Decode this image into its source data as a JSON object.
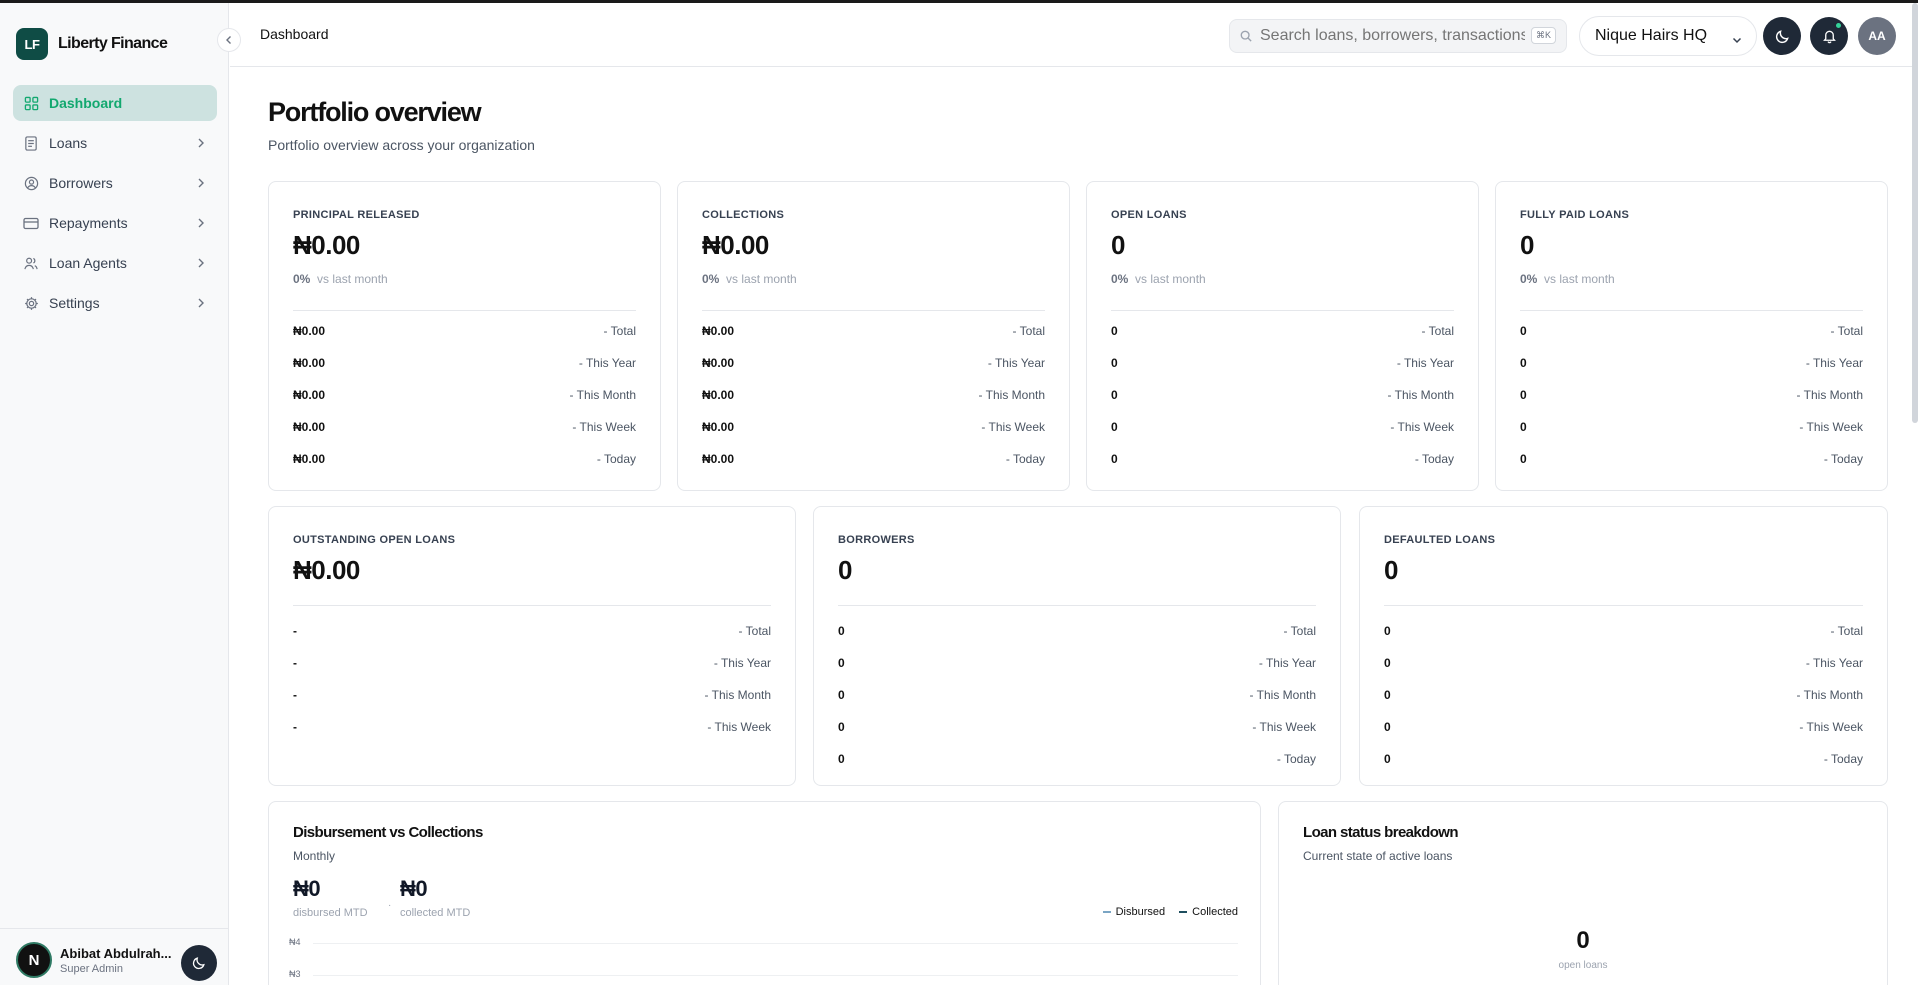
{
  "app": {
    "logo_initials": "LF",
    "name": "Liberty Finance"
  },
  "sidebar": {
    "items": [
      {
        "label": "Dashboard",
        "icon": "grid-icon",
        "active": true
      },
      {
        "label": "Loans",
        "icon": "document-icon"
      },
      {
        "label": "Borrowers",
        "icon": "user-circle-icon"
      },
      {
        "label": "Repayments",
        "icon": "credit-card-icon"
      },
      {
        "label": "Loan Agents",
        "icon": "users-icon"
      },
      {
        "label": "Settings",
        "icon": "gear-icon"
      }
    ],
    "user": {
      "avatar_letter": "N",
      "name": "Abibat Abdulrah...",
      "role": "Super Admin"
    }
  },
  "topbar": {
    "breadcrumb": "Dashboard",
    "search_placeholder": "Search loans, borrowers, transactions",
    "search_shortcut": "⌘K",
    "org_name": "Nique Hairs HQ",
    "avatar_initials": "AA"
  },
  "page": {
    "title": "Portfolio overview",
    "subtitle": "Portfolio overview across your organization"
  },
  "cards_row1": [
    {
      "label": "PRINCIPAL RELEASED",
      "value": "₦0.00",
      "delta_pct": "0%",
      "delta_text": "vs last month",
      "rows": [
        {
          "v": "₦0.00",
          "p": "- Total"
        },
        {
          "v": "₦0.00",
          "p": "- This Year"
        },
        {
          "v": "₦0.00",
          "p": "- This Month"
        },
        {
          "v": "₦0.00",
          "p": "- This Week"
        },
        {
          "v": "₦0.00",
          "p": "- Today"
        }
      ]
    },
    {
      "label": "COLLECTIONS",
      "value": "₦0.00",
      "delta_pct": "0%",
      "delta_text": "vs last month",
      "rows": [
        {
          "v": "₦0.00",
          "p": "- Total"
        },
        {
          "v": "₦0.00",
          "p": "- This Year"
        },
        {
          "v": "₦0.00",
          "p": "- This Month"
        },
        {
          "v": "₦0.00",
          "p": "- This Week"
        },
        {
          "v": "₦0.00",
          "p": "- Today"
        }
      ]
    },
    {
      "label": "OPEN LOANS",
      "value": "0",
      "delta_pct": "0%",
      "delta_text": "vs last month",
      "rows": [
        {
          "v": "0",
          "p": "- Total"
        },
        {
          "v": "0",
          "p": "- This Year"
        },
        {
          "v": "0",
          "p": "- This Month"
        },
        {
          "v": "0",
          "p": "- This Week"
        },
        {
          "v": "0",
          "p": "- Today"
        }
      ]
    },
    {
      "label": "FULLY PAID LOANS",
      "value": "0",
      "delta_pct": "0%",
      "delta_text": "vs last month",
      "rows": [
        {
          "v": "0",
          "p": "- Total"
        },
        {
          "v": "0",
          "p": "- This Year"
        },
        {
          "v": "0",
          "p": "- This Month"
        },
        {
          "v": "0",
          "p": "- This Week"
        },
        {
          "v": "0",
          "p": "- Today"
        }
      ]
    }
  ],
  "cards_row2": [
    {
      "label": "OUTSTANDING OPEN LOANS",
      "value": "₦0.00",
      "rows": [
        {
          "v": "-",
          "p": "- Total"
        },
        {
          "v": "-",
          "p": "- This Year"
        },
        {
          "v": "-",
          "p": "- This Month"
        },
        {
          "v": "-",
          "p": "- This Week"
        }
      ]
    },
    {
      "label": "BORROWERS",
      "value": "0",
      "rows": [
        {
          "v": "0",
          "p": "- Total"
        },
        {
          "v": "0",
          "p": "- This Year"
        },
        {
          "v": "0",
          "p": "- This Month"
        },
        {
          "v": "0",
          "p": "- This Week"
        },
        {
          "v": "0",
          "p": "- Today"
        }
      ]
    },
    {
      "label": "DEFAULTED LOANS",
      "value": "0",
      "rows": [
        {
          "v": "0",
          "p": "- Total"
        },
        {
          "v": "0",
          "p": "- This Year"
        },
        {
          "v": "0",
          "p": "- This Month"
        },
        {
          "v": "0",
          "p": "- This Week"
        },
        {
          "v": "0",
          "p": "- Today"
        }
      ]
    }
  ],
  "disbursement": {
    "title": "Disbursement vs Collections",
    "subtitle": "Monthly",
    "disbursed_value": "₦0",
    "disbursed_label": "disbursed MTD",
    "collected_value": "₦0",
    "collected_label": "collected MTD",
    "legend": [
      {
        "name": "Disbursed",
        "color": "#7aa5c4"
      },
      {
        "name": "Collected",
        "color": "#1f4e5f"
      }
    ],
    "y_ticks": [
      "₦4",
      "₦3"
    ]
  },
  "status": {
    "title": "Loan status breakdown",
    "subtitle": "Current state of active loans",
    "count": "0",
    "count_label": "open loans"
  },
  "colors": {
    "brand": "#0f4c45",
    "accent": "#12a86f",
    "active_bg": "#cde2e0"
  }
}
